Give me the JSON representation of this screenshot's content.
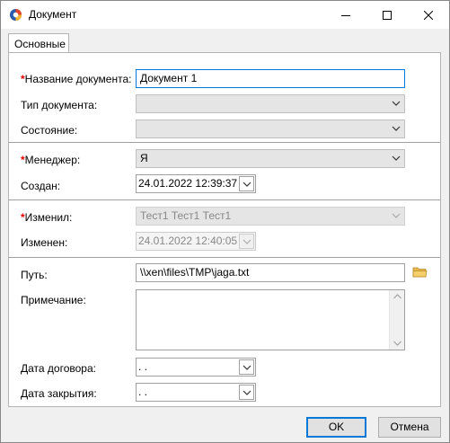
{
  "window": {
    "title": "Документ"
  },
  "tabs": [
    {
      "label": "Основные"
    }
  ],
  "form": {
    "name_label": "Название документа:",
    "name_value": "Документ 1",
    "type_label": "Тип документа:",
    "type_value": "",
    "state_label": "Состояние:",
    "state_value": "",
    "manager_label": "Менеджер:",
    "manager_value": "Я",
    "created_label": "Создан:",
    "created_value": "24.01.2022 12:39:37",
    "changed_by_label": "Изменил:",
    "changed_by_value": "Тест1 Тест1 Тест1",
    "changed_label": "Изменен:",
    "changed_value": "24.01.2022 12:40:05",
    "path_label": "Путь:",
    "path_value": "\\\\xen\\files\\TMP\\jaga.txt",
    "note_label": "Примечание:",
    "note_value": "",
    "contract_date_label": "Дата договора:",
    "contract_date_value": " .  .",
    "close_date_label": "Дата закрытия:",
    "close_date_value": " .  ."
  },
  "required_marker": "*",
  "buttons": {
    "ok": "OK",
    "cancel": "Отмена"
  },
  "icons": [
    "app-icon",
    "minimize-icon",
    "maximize-icon",
    "close-icon",
    "chevron-down-icon",
    "calendar-dropdown-icon",
    "folder-icon"
  ],
  "colors": {
    "required": "#e00000",
    "focus": "#0078d7",
    "folder": "#e8b84a"
  }
}
